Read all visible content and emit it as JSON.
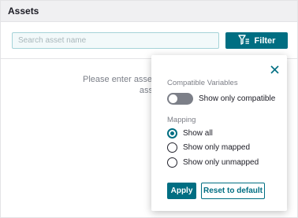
{
  "header": {
    "title": "Assets"
  },
  "search": {
    "placeholder": "Search asset name",
    "value": ""
  },
  "filter": {
    "label": "Filter",
    "icon": "filter-icon"
  },
  "empty_state": {
    "line1": "Please enter asset name to search",
    "line2": "asset"
  },
  "popover": {
    "close_icon": "close-icon",
    "compatible_section": "Compatible Variables",
    "toggle_label": "Show only compatible",
    "toggle_on": false,
    "mapping_section": "Mapping",
    "options": [
      {
        "label": "Show all",
        "checked": true
      },
      {
        "label": "Show only mapped",
        "checked": false
      },
      {
        "label": "Show only unmapped",
        "checked": false
      }
    ],
    "apply_label": "Apply",
    "reset_label": "Reset to default"
  },
  "colors": {
    "accent": "#006e82",
    "header_bg": "#f0f0f2",
    "toggle_off": "#7c7f88",
    "text_muted": "#7b7f88"
  }
}
